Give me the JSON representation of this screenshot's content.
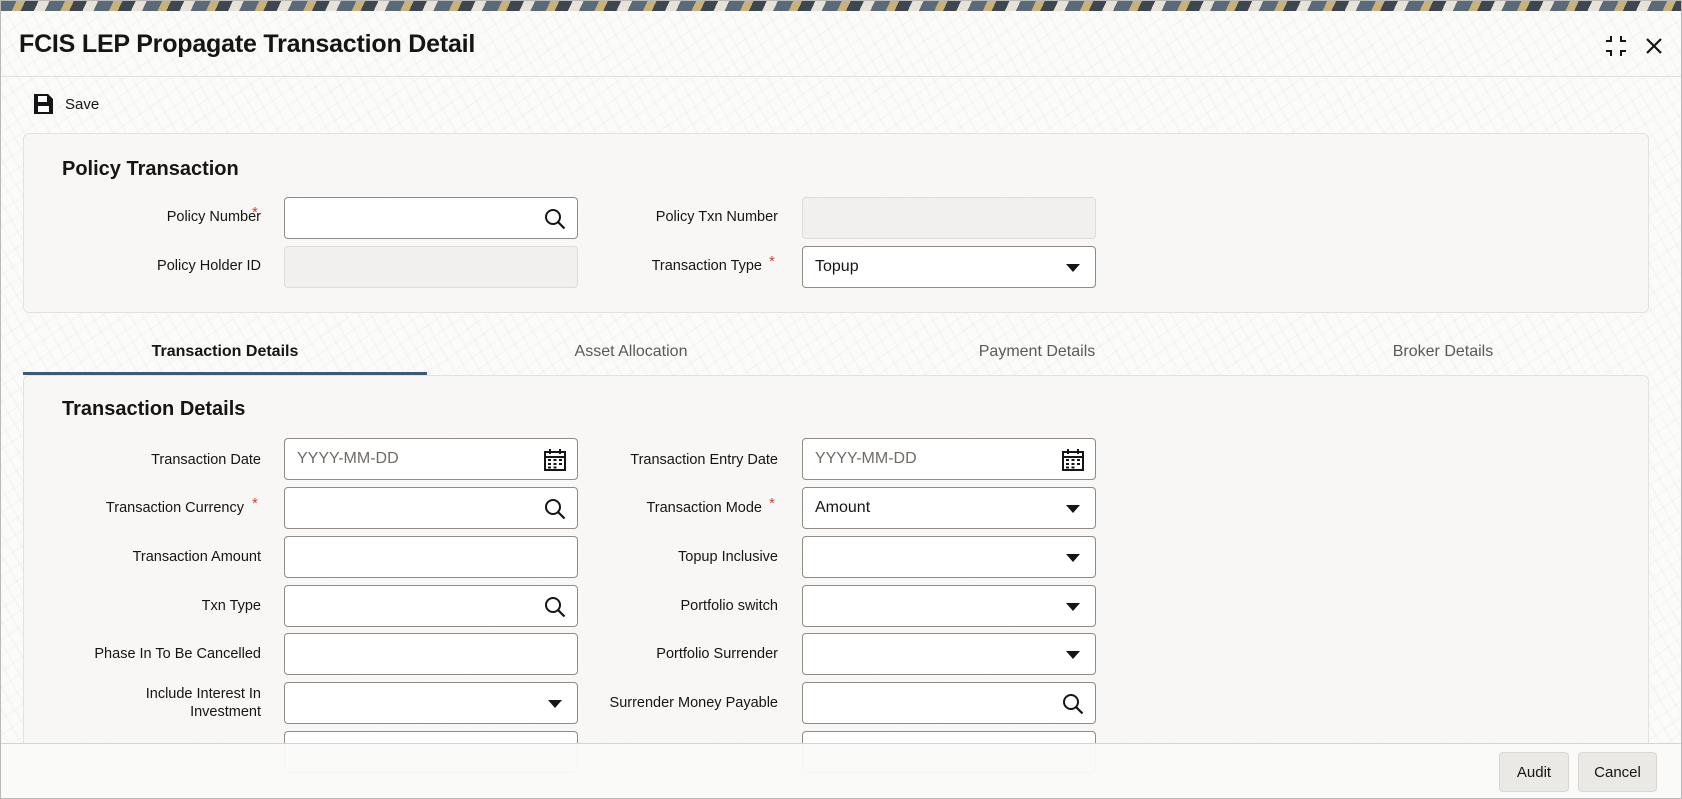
{
  "window": {
    "title": "FCIS LEP Propagate Transaction Detail"
  },
  "toolbar": {
    "save_label": "Save"
  },
  "policy_transaction": {
    "title": "Policy Transaction",
    "policy_number": {
      "label": "Policy Number",
      "value": ""
    },
    "policy_txn_number": {
      "label": "Policy Txn Number",
      "value": ""
    },
    "policy_holder_id": {
      "label": "Policy Holder ID",
      "value": ""
    },
    "transaction_type": {
      "label": "Transaction Type",
      "value": "Topup"
    }
  },
  "tabs": [
    {
      "label": "Transaction Details",
      "active": true
    },
    {
      "label": "Asset Allocation",
      "active": false
    },
    {
      "label": "Payment Details",
      "active": false
    },
    {
      "label": "Broker Details",
      "active": false
    }
  ],
  "transaction_details": {
    "title": "Transaction Details",
    "transaction_date": {
      "label": "Transaction Date",
      "placeholder": "YYYY-MM-DD"
    },
    "transaction_entry_date": {
      "label": "Transaction Entry Date",
      "placeholder": "YYYY-MM-DD"
    },
    "transaction_currency": {
      "label": "Transaction Currency",
      "value": ""
    },
    "transaction_mode": {
      "label": "Transaction Mode",
      "value": "Amount"
    },
    "transaction_amount": {
      "label": "Transaction Amount",
      "value": ""
    },
    "topup_inclusive": {
      "label": "Topup Inclusive",
      "value": ""
    },
    "txn_type": {
      "label": "Txn Type",
      "value": ""
    },
    "portfolio_switch": {
      "label": "Portfolio switch",
      "value": ""
    },
    "phase_in_cancelled": {
      "label": "Phase In To Be Cancelled",
      "value": ""
    },
    "portfolio_surrender": {
      "label": "Portfolio Surrender",
      "value": ""
    },
    "include_interest": {
      "label_line1": "Include Interest In",
      "label_line2": "Investment",
      "value": ""
    },
    "surrender_money_payable": {
      "label": "Surrender Money Payable",
      "value": ""
    }
  },
  "required_mark": "*",
  "footer": {
    "audit_label": "Audit",
    "cancel_label": "Cancel"
  }
}
